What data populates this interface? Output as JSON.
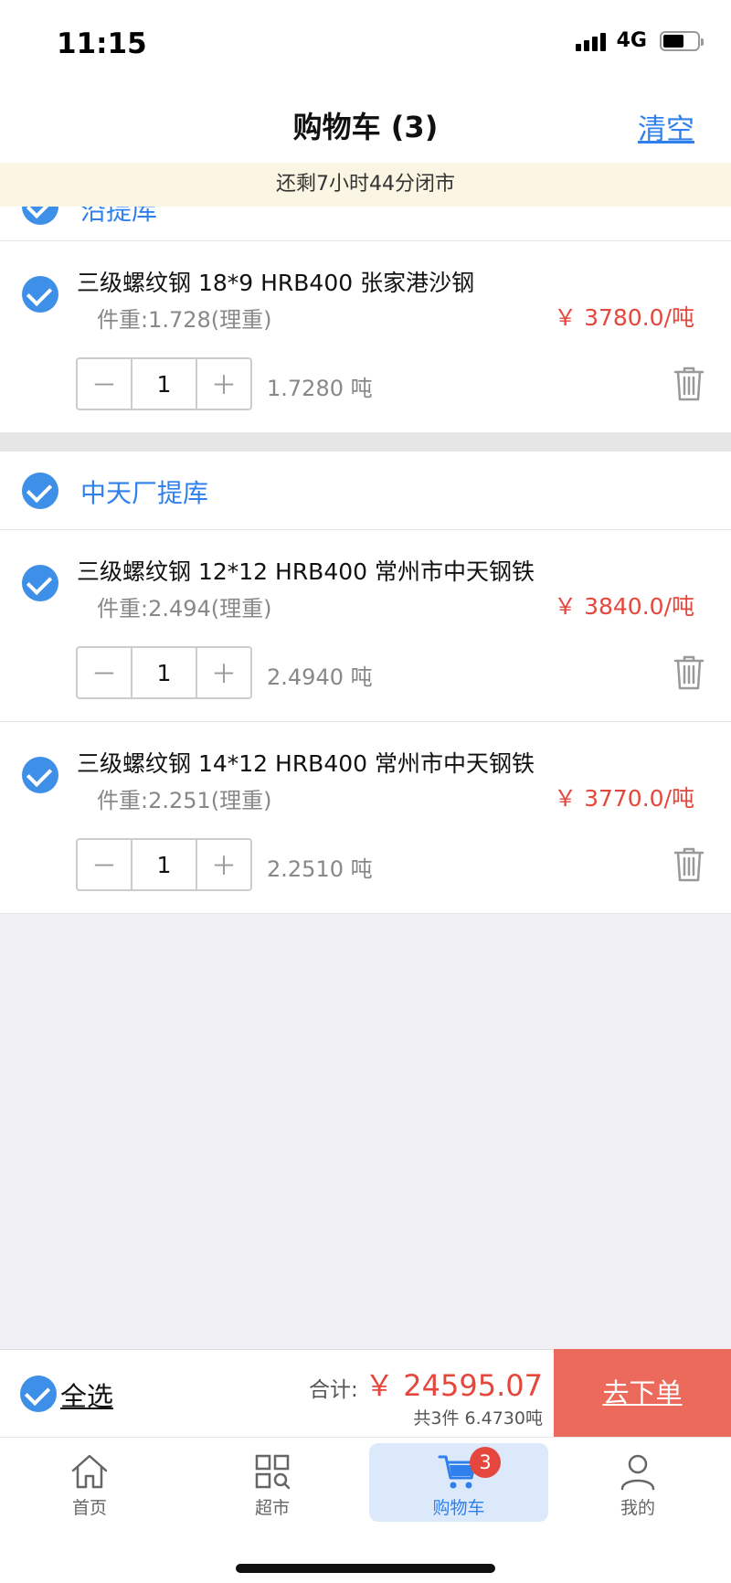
{
  "status_bar": {
    "time": "11:15",
    "network": "4G"
  },
  "header": {
    "title": "购物车 (3)",
    "clear_label": "清空"
  },
  "notice": "还剩7小时44分闭市",
  "groups": [
    {
      "name": "沿提库",
      "items": [
        {
          "name": "三级螺纹钢 18*9 HRB400 张家港沙钢",
          "weight": "件重:1.728(理重)",
          "price": "￥ 3780.0/吨",
          "qty": "1",
          "tons": "1.7280 吨"
        }
      ]
    },
    {
      "name": "中天厂提库",
      "items": [
        {
          "name": "三级螺纹钢 12*12 HRB400 常州市中天钢铁",
          "weight": "件重:2.494(理重)",
          "price": "￥ 3840.0/吨",
          "qty": "1",
          "tons": "2.4940 吨"
        },
        {
          "name": "三级螺纹钢 14*12 HRB400 常州市中天钢铁",
          "weight": "件重:2.251(理重)",
          "price": "￥ 3770.0/吨",
          "qty": "1",
          "tons": "2.2510 吨"
        }
      ]
    }
  ],
  "stepper": {
    "minus": "－",
    "plus": "＋"
  },
  "bottom": {
    "select_all": "全选",
    "total_label": "合计:",
    "total_amount": "￥ 24595.07",
    "total_sub": "共3件 6.4730吨",
    "order_button": "去下单"
  },
  "tabs": [
    {
      "label": "首页",
      "icon": "home-icon"
    },
    {
      "label": "超市",
      "icon": "market-icon"
    },
    {
      "label": "购物车",
      "icon": "cart-icon",
      "badge": "3",
      "active": true
    },
    {
      "label": "我的",
      "icon": "user-icon"
    }
  ],
  "colors": {
    "accent": "#2f80ed",
    "price": "#e5473c",
    "order_button": "#ec6a5c",
    "notice_bg": "#faf6e3"
  }
}
